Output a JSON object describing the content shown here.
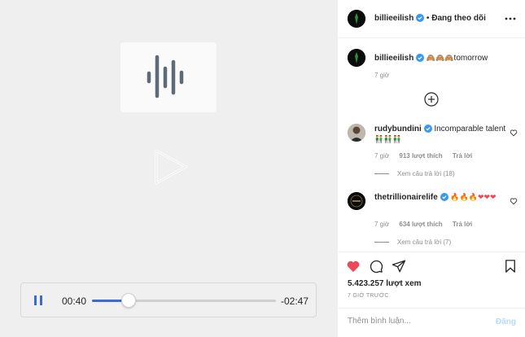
{
  "player": {
    "current_time": "00:40",
    "remaining_time": "-02:47",
    "progress": 0.2
  },
  "post": {
    "author": "billieeilish",
    "follow_status": "Đang theo dõi",
    "separator": "•"
  },
  "caption": {
    "username": "billieeilish",
    "emojis": "🙈🙈🙈",
    "text": "tomorrow",
    "time": "7 giờ"
  },
  "comments": [
    {
      "username": "rudybundini",
      "text": "Incomparable talent",
      "emojis": "👬👬👬",
      "time": "7 giờ",
      "likes": "913 lượt thích",
      "reply_label": "Trả lời",
      "view_replies": "Xem câu trả lời (18)"
    },
    {
      "username": "thetrillionairelife",
      "emojis": "🔥🔥🔥❤❤❤",
      "time": "7 giờ",
      "likes": "634 lượt thích",
      "reply_label": "Trả lời",
      "view_replies": "Xem câu trả lời (7)"
    }
  ],
  "stats": {
    "views": "5.423.257 lượt xem",
    "posted_ago": "7 GIỜ TRƯỚC"
  },
  "comment_input": {
    "placeholder": "Thêm bình luận...",
    "post_label": "Đăng"
  },
  "colors": {
    "like_red": "#ed4956",
    "verified_blue": "#3897f0",
    "progress_blue": "#3b6ad6",
    "post_disabled": "#b3dbff"
  },
  "icons": [
    "waveform-icon",
    "play-icon",
    "pause-icon",
    "verified-icon",
    "more-icon",
    "plus-circle-icon",
    "heart-icon",
    "comment-icon",
    "share-icon",
    "bookmark-icon"
  ]
}
